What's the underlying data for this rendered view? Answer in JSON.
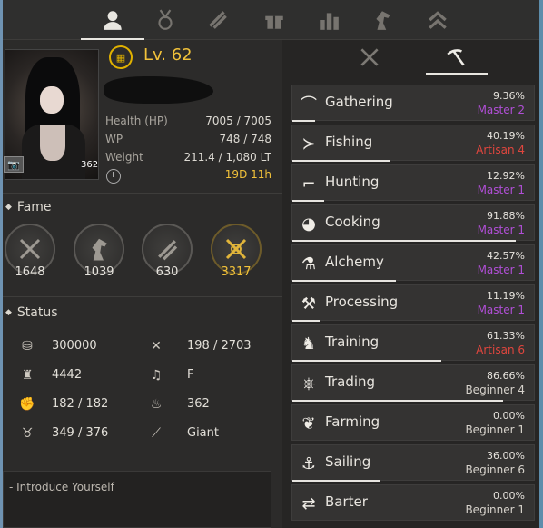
{
  "colors": {
    "accent_gold": "#f2c23a",
    "master_purple": "#b04fd6",
    "artisan_red": "#e0463e",
    "beginner_grey": "#d6d2cb"
  },
  "top_tabs": [
    {
      "icon": "person-icon",
      "active": true
    },
    {
      "icon": "medal-icon",
      "active": false
    },
    {
      "icon": "scroll-icon",
      "active": false
    },
    {
      "icon": "gift-icon",
      "active": false
    },
    {
      "icon": "bar-chart-icon",
      "active": false
    },
    {
      "icon": "horse-icon",
      "active": false
    },
    {
      "icon": "chevrons-up-icon",
      "active": false
    }
  ],
  "character": {
    "level": "Lv. 62",
    "portrait_badge": "362",
    "stats": [
      {
        "label": "Health (HP)",
        "value": "7005 / 7005"
      },
      {
        "label": "WP",
        "value": "748 / 748"
      },
      {
        "label": "Weight",
        "value": "211.4 / 1,080 LT"
      }
    ],
    "time": "19D 11h"
  },
  "fame": {
    "title": "Fame",
    "items": [
      {
        "icon": "swords-icon",
        "value": "1648"
      },
      {
        "icon": "horse-head-icon",
        "value": "1039"
      },
      {
        "icon": "scroll-icon",
        "value": "630"
      },
      {
        "icon": "crossed-swords-gold-icon",
        "value": "3317"
      }
    ]
  },
  "status": {
    "title": "Status",
    "items": [
      {
        "icon": "silver-coin-icon",
        "value": "300000"
      },
      {
        "icon": "tools-icon",
        "value": "198 / 2703"
      },
      {
        "icon": "helmet-icon",
        "value": "4442"
      },
      {
        "icon": "music-note-icon",
        "value": "F"
      },
      {
        "icon": "fist-icon",
        "value": "182 / 182"
      },
      {
        "icon": "flame-icon",
        "value": "362"
      },
      {
        "icon": "medal-icon",
        "value": "349 / 376"
      },
      {
        "icon": "syringe-icon",
        "value": "Giant"
      }
    ]
  },
  "intro_label": "- Introduce Yourself",
  "right_tabs": [
    {
      "icon": "crossed-swords-icon",
      "active": false
    },
    {
      "icon": "pickaxe-icon",
      "active": true
    }
  ],
  "life_skills": [
    {
      "name": "Gathering",
      "icon": "sickle-icon",
      "percent": "9.36%",
      "rank": "Master 2",
      "tier": "master",
      "progress": 0.0936
    },
    {
      "name": "Fishing",
      "icon": "fish-icon",
      "percent": "40.19%",
      "rank": "Artisan 4",
      "tier": "artisan",
      "progress": 0.4019
    },
    {
      "name": "Hunting",
      "icon": "rifle-icon",
      "percent": "12.92%",
      "rank": "Master 1",
      "tier": "master",
      "progress": 0.1292
    },
    {
      "name": "Cooking",
      "icon": "roast-icon",
      "percent": "91.88%",
      "rank": "Master 1",
      "tier": "master",
      "progress": 0.9188
    },
    {
      "name": "Alchemy",
      "icon": "flask-icon",
      "percent": "42.57%",
      "rank": "Master 1",
      "tier": "master",
      "progress": 0.4257
    },
    {
      "name": "Processing",
      "icon": "hammer-icon",
      "percent": "11.19%",
      "rank": "Master 1",
      "tier": "master",
      "progress": 0.1119
    },
    {
      "name": "Training",
      "icon": "horse-head-icon",
      "percent": "61.33%",
      "rank": "Artisan 6",
      "tier": "artisan",
      "progress": 0.6133
    },
    {
      "name": "Trading",
      "icon": "ship-wheel-icon",
      "percent": "86.66%",
      "rank": "Beginner 4",
      "tier": "beginner",
      "progress": 0.8666
    },
    {
      "name": "Farming",
      "icon": "sprout-icon",
      "percent": "0.00%",
      "rank": "Beginner 1",
      "tier": "beginner",
      "progress": 0.0
    },
    {
      "name": "Sailing",
      "icon": "anchor-icon",
      "percent": "36.00%",
      "rank": "Beginner 6",
      "tier": "beginner",
      "progress": 0.36
    },
    {
      "name": "Barter",
      "icon": "exchange-arrows-icon",
      "percent": "0.00%",
      "rank": "Beginner 1",
      "tier": "beginner",
      "progress": 0.0
    }
  ]
}
